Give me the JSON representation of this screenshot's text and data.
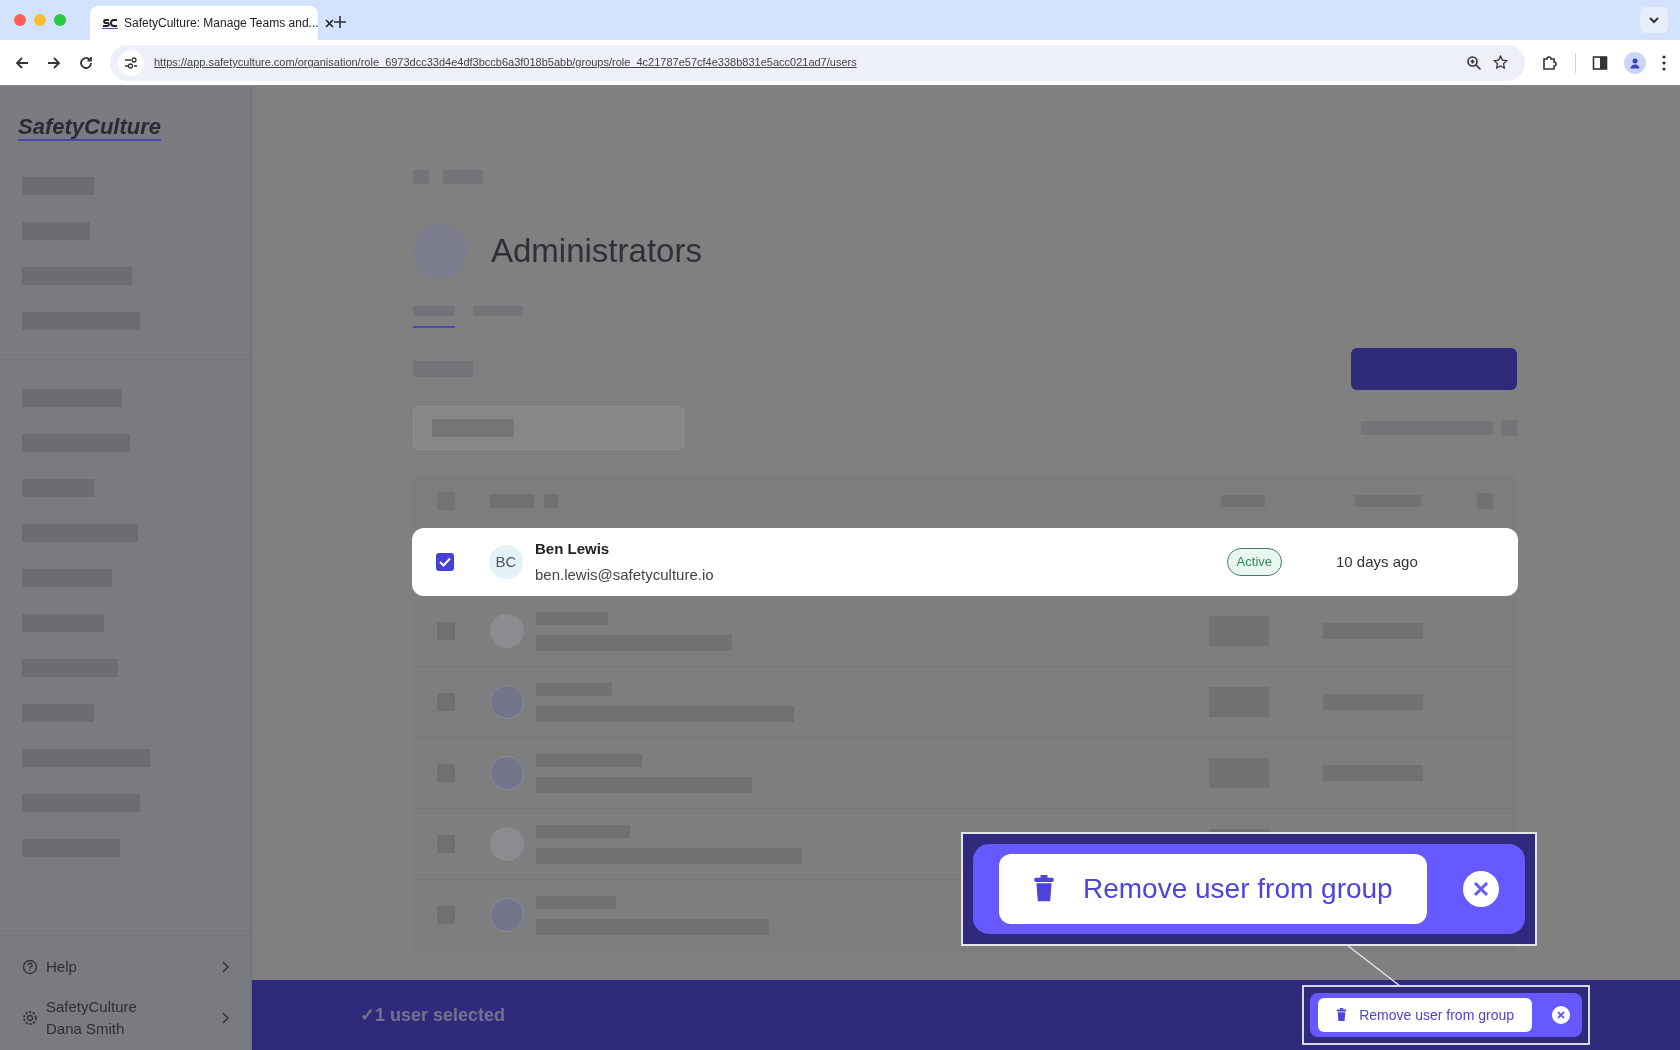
{
  "browser": {
    "tabs": [
      {
        "title": "SafetyCulture: Manage Teams and...",
        "selected": true
      }
    ],
    "url": "https://app.safetyculture.com/organisation/role_6973dcc33d4e4df3bccb6a3f018b5abb/groups/role_4c21787e57cf4e338b831e5acc021ad7/users"
  },
  "sidebar": {
    "logo": "SafetyCulture",
    "footer": [
      {
        "kind": "link",
        "label": "Help"
      },
      {
        "kind": "account",
        "lines": [
          "SafetyCulture",
          "Dana Smith"
        ]
      }
    ]
  },
  "page": {
    "title": "Administrators"
  },
  "selected_row": {
    "checked": true,
    "initials": "BC",
    "name": "Ben Lewis",
    "email": "ben.lewis@safetyculture.io",
    "status": "Active",
    "last_active": "10 days ago"
  },
  "bottom_bar": {
    "selection": "✓1 user selected",
    "action": "Remove user from group"
  },
  "callout": {
    "action": "Remove user from group"
  }
}
